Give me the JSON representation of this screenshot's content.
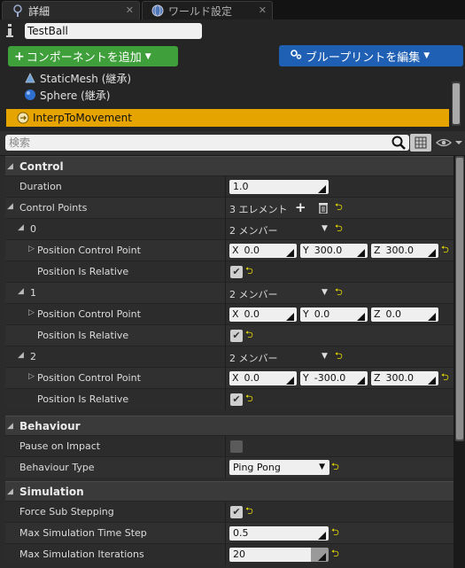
{
  "tabs": [
    {
      "label": "詳細",
      "active": true
    },
    {
      "label": "ワールド設定",
      "active": false
    }
  ],
  "header": {
    "actor_name": "TestBall",
    "add_component_label": "コンポーネントを追加",
    "blueprint_label": "ブループリントを編集"
  },
  "components": [
    {
      "label": "StaticMesh (継承)",
      "icon": "static-mesh-icon"
    },
    {
      "label": "Sphere (継承)",
      "icon": "sphere-icon"
    },
    {
      "label": "InterpToMovement",
      "icon": "movement-component-icon",
      "selected": true
    }
  ],
  "search": {
    "placeholder": "検索"
  },
  "sections": {
    "control": "Control",
    "behaviour": "Behaviour",
    "simulation": "Simulation"
  },
  "control": {
    "duration_label": "Duration",
    "duration_value": "1.0",
    "control_points_label": "Control Points",
    "control_points_count": "3 エレメント",
    "points": [
      {
        "index": "0",
        "members": "2 メンバー",
        "pos_label": "Position Control Point",
        "x": "0.0",
        "y": "300.0",
        "z": "300.0",
        "relative_label": "Position Is Relative",
        "relative": true
      },
      {
        "index": "1",
        "members": "2 メンバー",
        "pos_label": "Position Control Point",
        "x": "0.0",
        "y": "0.0",
        "z": "0.0",
        "relative_label": "Position Is Relative",
        "relative": true
      },
      {
        "index": "2",
        "members": "2 メンバー",
        "pos_label": "Position Control Point",
        "x": "0.0",
        "y": "-300.0",
        "z": "300.0",
        "relative_label": "Position Is Relative",
        "relative": true
      }
    ],
    "axis_x": "X",
    "axis_y": "Y",
    "axis_z": "Z"
  },
  "behaviour": {
    "pause_label": "Pause on Impact",
    "pause_checked": false,
    "type_label": "Behaviour Type",
    "type_value": "Ping Pong"
  },
  "simulation": {
    "force_label": "Force Sub Stepping",
    "force_checked": true,
    "max_step_label": "Max Simulation Time Step",
    "max_step_value": "0.5",
    "max_iter_label": "Max Simulation Iterations",
    "max_iter_value": "20"
  },
  "colors": {
    "accent_selected": "#e5a400",
    "add_button": "#3f9f3a",
    "blueprint_button": "#1f5fb4",
    "reset_arrow": "#e9d900"
  }
}
